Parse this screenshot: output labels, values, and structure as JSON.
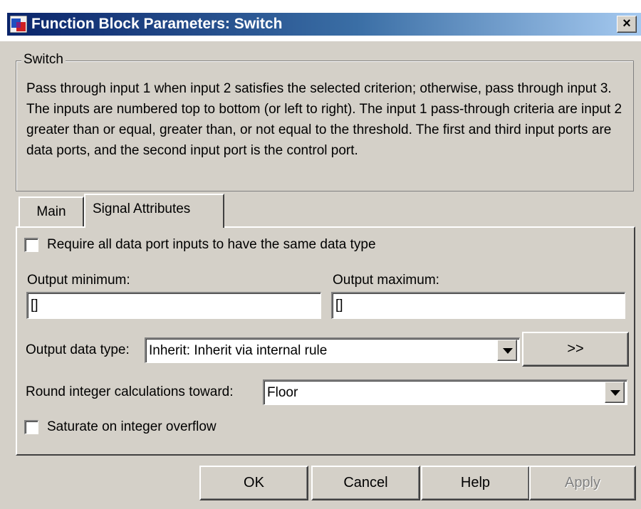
{
  "window": {
    "title": "Function Block Parameters: Switch",
    "close_glyph": "×",
    "icon": "simulink-block-icon"
  },
  "group": {
    "legend": "Switch",
    "description": "Pass through input 1 when input 2 satisfies the selected criterion; otherwise, pass through input 3.  The inputs are numbered top to bottom (or left to right). The input 1 pass-through criteria are input 2 greater than or equal, greater than, or not equal to the threshold.  The first and third input ports are data ports, and the second input port is the control port."
  },
  "tabs": [
    {
      "label": "Main",
      "active": false
    },
    {
      "label": "Signal Attributes",
      "active": true
    }
  ],
  "signal_attributes": {
    "require_same_type": {
      "label": "Require all data port inputs to have the same data type",
      "checked": false
    },
    "output_minimum": {
      "label": "Output minimum:",
      "value": "[]"
    },
    "output_maximum": {
      "label": "Output maximum:",
      "value": "[]"
    },
    "output_data_type": {
      "label": "Output data type:",
      "value": "Inherit: Inherit via internal rule",
      "assistant_label": ">>"
    },
    "round_integer": {
      "label": "Round integer calculations toward:",
      "value": "Floor"
    },
    "saturate": {
      "label": "Saturate on integer overflow",
      "checked": false
    }
  },
  "buttons": {
    "ok": "OK",
    "cancel": "Cancel",
    "help": "Help",
    "apply": "Apply",
    "apply_enabled": false
  }
}
